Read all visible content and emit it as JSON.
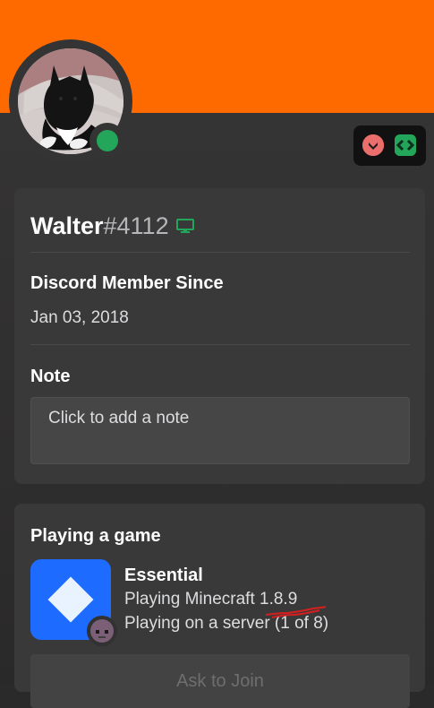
{
  "profile": {
    "username": "Walter",
    "discriminator": "#4112",
    "status": "online",
    "status_color": "#23a55a",
    "banner_color": "#ff6a00",
    "device_icon": "desktop-icon"
  },
  "badges": [
    {
      "name": "hypesquad-badge",
      "color": "#ea6e6b"
    },
    {
      "name": "developer-badge",
      "color": "#23a55a"
    }
  ],
  "member_since": {
    "label": "Discord Member Since",
    "date": "Jan 03, 2018"
  },
  "note": {
    "label": "Note",
    "placeholder": "Click to add a note"
  },
  "activity": {
    "label": "Playing a game",
    "game_name": "Essential",
    "details": "Playing Minecraft 1.8.9",
    "state": "Playing on a server (1 of 8)",
    "button": "Ask to Join"
  }
}
